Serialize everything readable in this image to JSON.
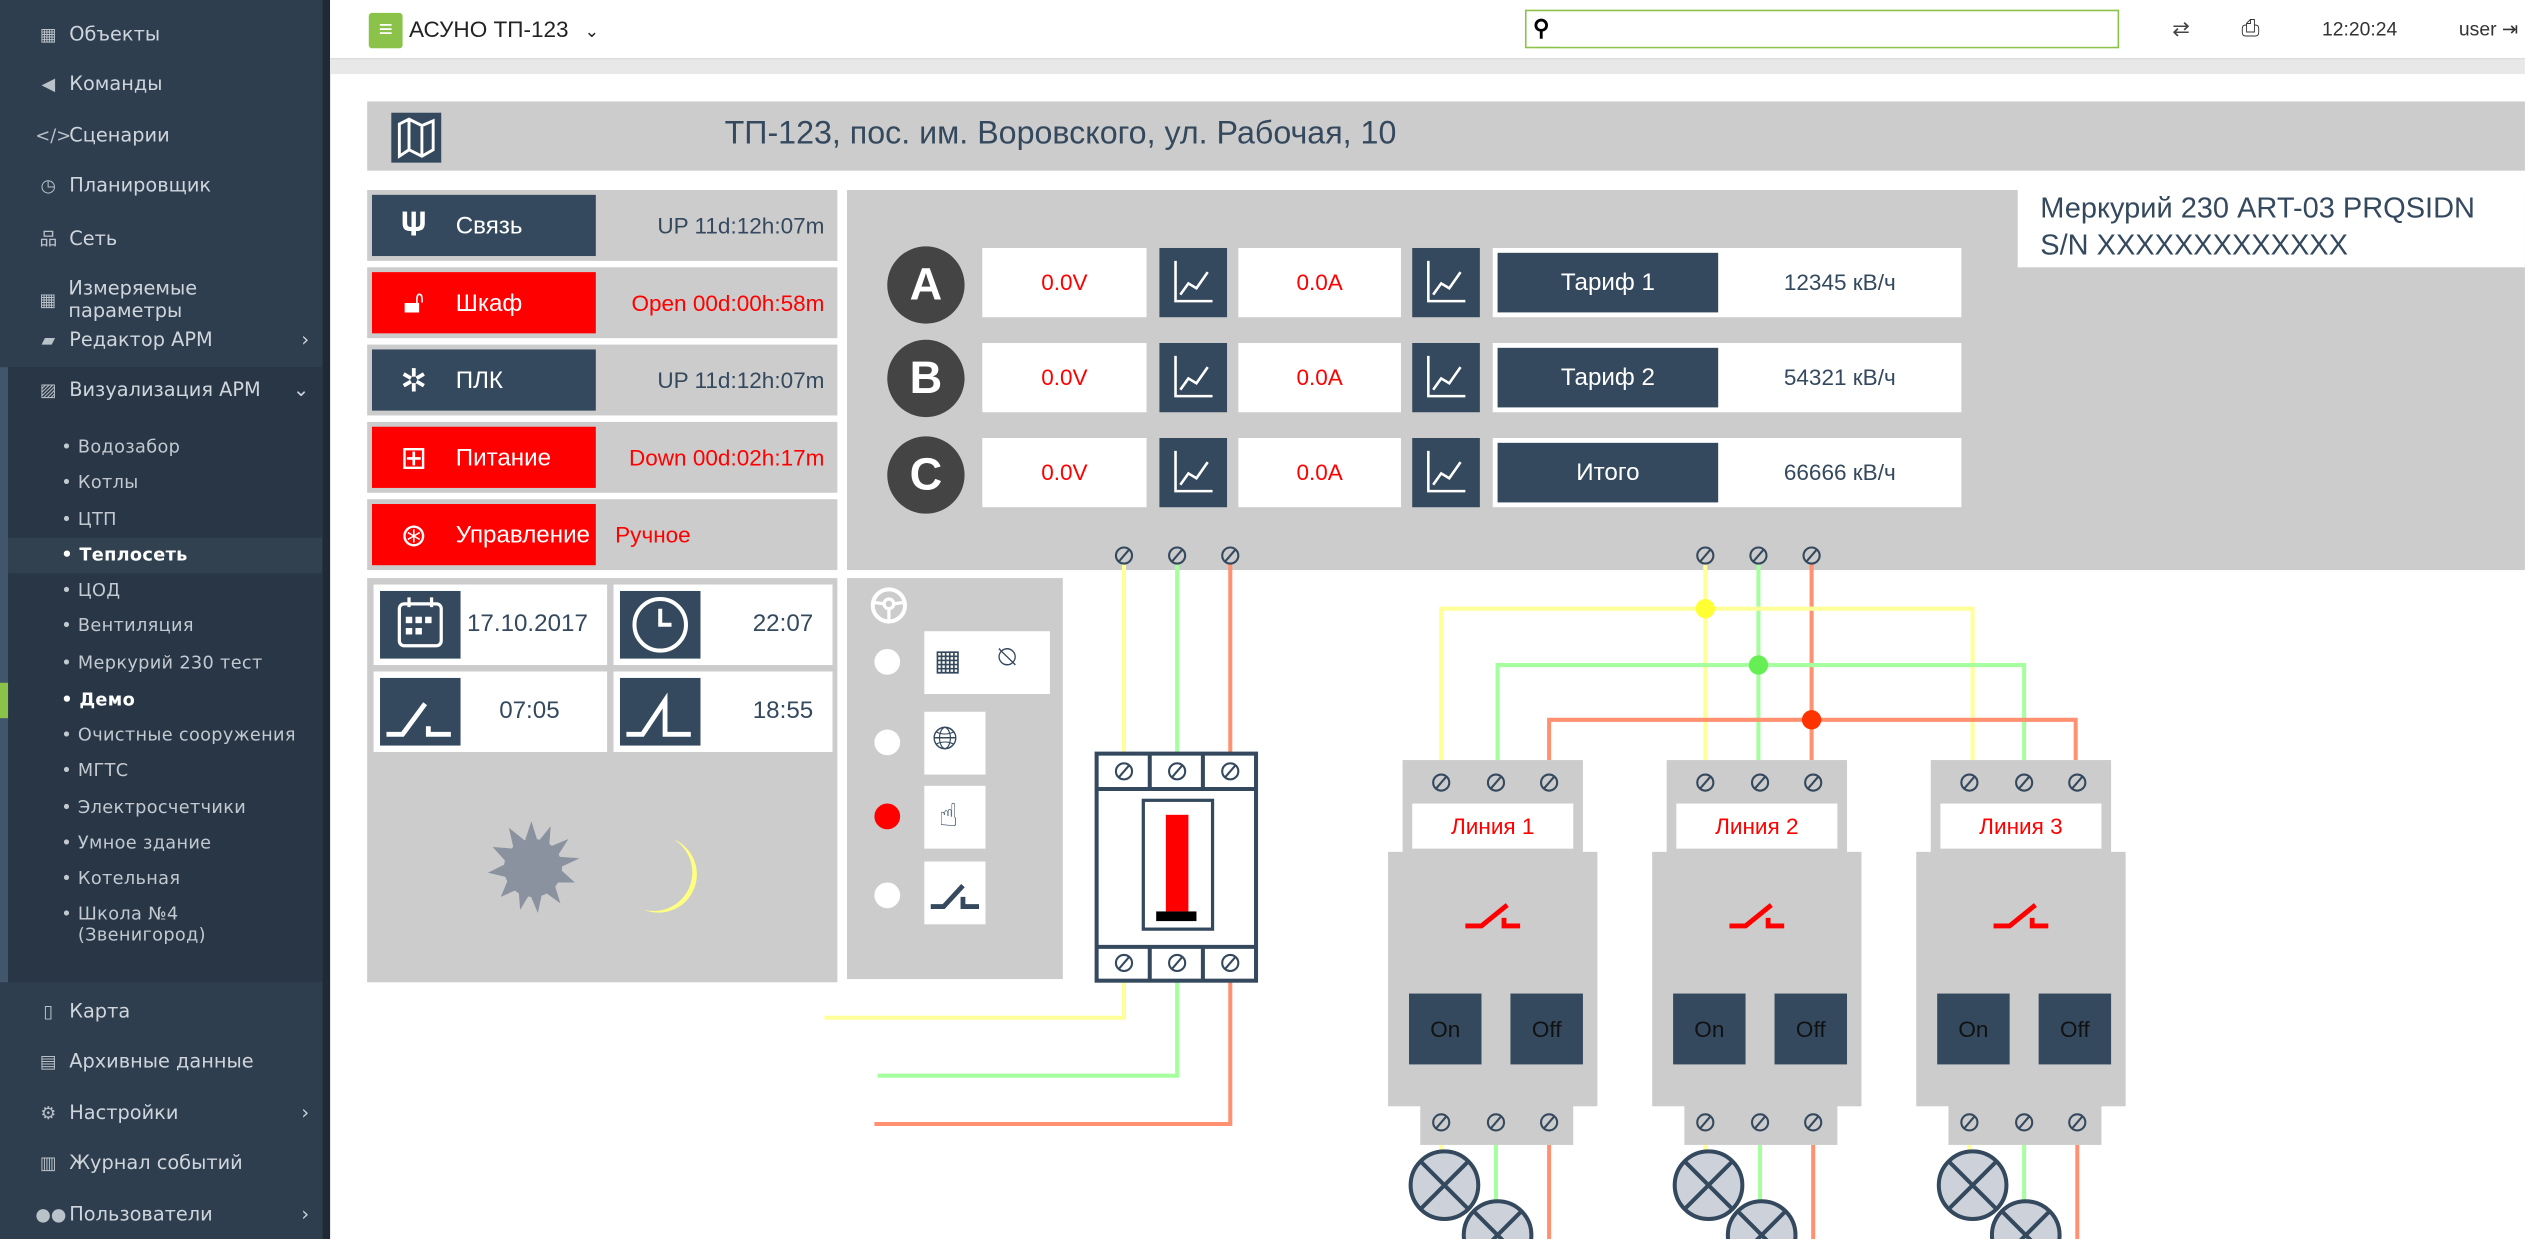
{
  "sidebar": {
    "items_top": [
      {
        "label": "Объекты",
        "icon": "building-icon",
        "glyph": "▦"
      },
      {
        "label": "Команды",
        "icon": "bullhorn-icon",
        "glyph": "📢"
      },
      {
        "label": "Сценарии",
        "icon": "code-icon",
        "glyph": "</>"
      },
      {
        "label": "Планировщик",
        "icon": "clock-icon",
        "glyph": "◷"
      },
      {
        "label": "Сеть",
        "icon": "sitemap-icon",
        "glyph": "品"
      },
      {
        "label": "Измеряемые параметры",
        "icon": "building-icon",
        "glyph": "▦"
      },
      {
        "label": "Редактор АРМ",
        "icon": "book-icon",
        "glyph": "▰",
        "chevron": "›"
      },
      {
        "label": "Визуализация АРМ",
        "icon": "image-icon",
        "glyph": "▨",
        "chevron": "⌄"
      }
    ],
    "submenu": [
      "Водозабор",
      "Котлы",
      "ЦТП",
      "Теплосеть",
      "ЦОД",
      "Вентиляция",
      "Меркурий 230 тест",
      "Демо",
      "Очистные сооружения",
      "МГТС",
      "Электросчетчики",
      "Умное здание",
      "Котельная",
      "Школа №4 (Звенигород)"
    ],
    "active_submenu": "Теплосеть",
    "items_bottom": [
      {
        "label": "Карта",
        "icon": "map-icon",
        "glyph": "▯▯"
      },
      {
        "label": "Архивные данные",
        "icon": "file-text-icon",
        "glyph": "▤"
      },
      {
        "label": "Настройки",
        "icon": "gear-icon",
        "glyph": "⚙",
        "chevron": "›"
      },
      {
        "label": "Журнал событий",
        "icon": "newspaper-icon",
        "glyph": "▥"
      },
      {
        "label": "Пользователи",
        "icon": "users-icon",
        "glyph": "👥",
        "chevron": "›"
      }
    ]
  },
  "topbar": {
    "title": "АСУНО ТП-123",
    "search_value": "",
    "time": "12:20:24",
    "user": "user"
  },
  "header": {
    "title": "ТП-123, пос. им. Воровского, ул. Рабочая, 10"
  },
  "status": [
    {
      "label": "Связь",
      "value": "UP 11d:12h:07m",
      "alarm": false,
      "icon": "antenna-signal-icon"
    },
    {
      "label": "Шкаф",
      "value": "Open 00d:00h:58m",
      "alarm": true,
      "icon": "unlocked-padlock-icon"
    },
    {
      "label": "ПЛК",
      "value": "UP 11d:12h:07m",
      "alarm": false,
      "icon": "chip-icon"
    },
    {
      "label": "Питание",
      "value": "Down 00d:02h:17m",
      "alarm": true,
      "icon": "battery-icon"
    },
    {
      "label": "Управление",
      "value": "Ручное",
      "alarm": true,
      "icon": "steering-wheel-icon"
    }
  ],
  "meter": {
    "model": "Меркурий 230 ART-03 PRQSIDN",
    "serial": "S/N XXXXXXXXXXXXX",
    "phases": [
      {
        "name": "A",
        "voltage": "0.0V",
        "current": "0.0A"
      },
      {
        "name": "B",
        "voltage": "0.0V",
        "current": "0.0A"
      },
      {
        "name": "C",
        "voltage": "0.0V",
        "current": "0.0A"
      }
    ],
    "tariffs": [
      {
        "label": "Тариф 1",
        "value": "12345 кВ/ч"
      },
      {
        "label": "Тариф 2",
        "value": "54321 кВ/ч"
      },
      {
        "label": "Итого",
        "value": "66666 кВ/ч"
      }
    ]
  },
  "schedule": {
    "date": "17.10.2017",
    "time": "22:07",
    "on_time": "07:05",
    "off_time": "18:55"
  },
  "mode": {
    "options": [
      "schedule-photosensor",
      "remote-network",
      "manual",
      "switch"
    ],
    "selected_index": 2
  },
  "lines": [
    {
      "label": "Линия 1",
      "on": "On",
      "off": "Off"
    },
    {
      "label": "Линия 2",
      "on": "On",
      "off": "Off"
    },
    {
      "label": "Линия 3",
      "on": "On",
      "off": "Off"
    }
  ],
  "colors": {
    "sidebar": "#2f3e4e",
    "accent": "#8bc34a",
    "dark": "#34495e",
    "alarm": "#ff0000",
    "panel": "#cccccc",
    "wire_a": "#ffff99",
    "wire_b": "#a6ff9e",
    "wire_c": "#ff9070"
  }
}
